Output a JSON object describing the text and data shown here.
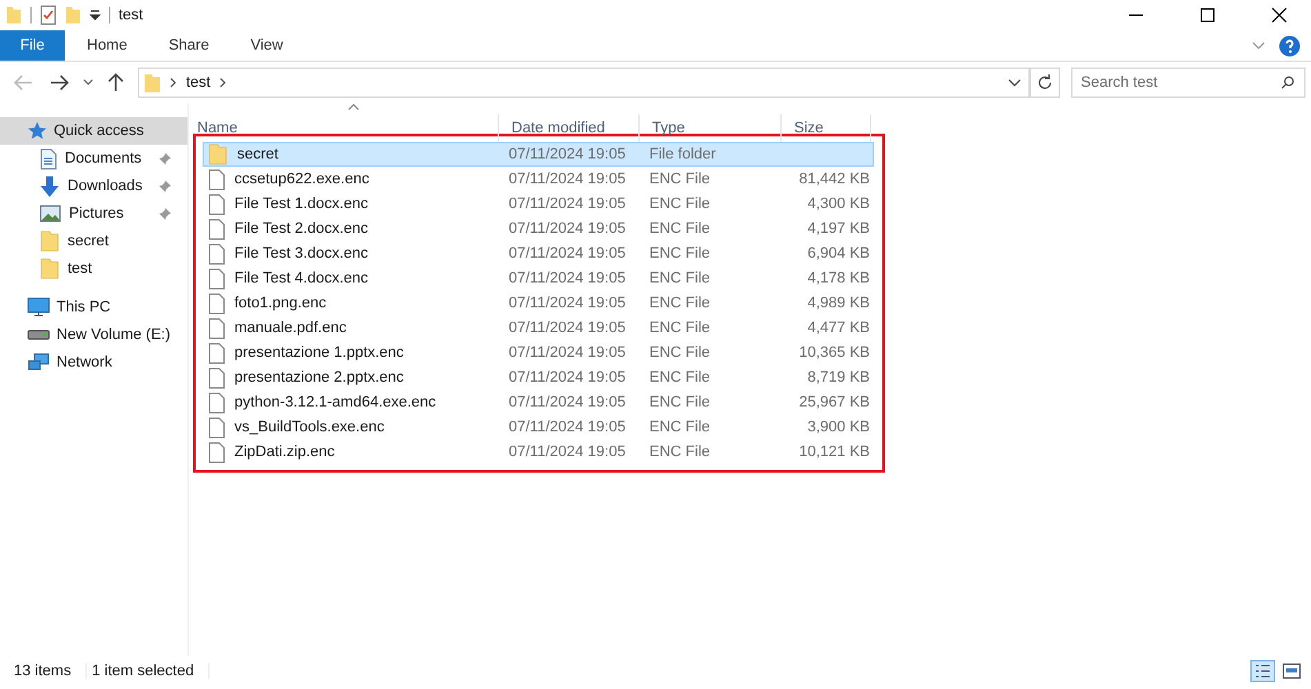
{
  "window": {
    "title": "test"
  },
  "ribbon": {
    "tabs": [
      {
        "label": "File",
        "kind": "file"
      },
      {
        "label": "Home",
        "kind": "tab",
        "selected": false
      },
      {
        "label": "Share",
        "kind": "tab",
        "selected": false
      },
      {
        "label": "View",
        "kind": "tab",
        "selected": false
      }
    ]
  },
  "address": {
    "path": [
      "test"
    ],
    "search_placeholder": "Search test"
  },
  "sidebar": {
    "items": [
      {
        "label": "Quick access",
        "kind": "star",
        "selected": true,
        "children": [
          {
            "label": "Documents",
            "kind": "documents",
            "pinned": true,
            "selected": false
          },
          {
            "label": "Downloads",
            "kind": "downloads",
            "pinned": true,
            "selected": false
          },
          {
            "label": "Pictures",
            "kind": "pictures",
            "pinned": true,
            "selected": false
          },
          {
            "label": "secret",
            "kind": "folder",
            "pinned": false,
            "selected": false
          },
          {
            "label": "test",
            "kind": "folder",
            "pinned": false,
            "selected": false
          }
        ]
      },
      {
        "label": "This PC",
        "kind": "pc",
        "selected": false
      },
      {
        "label": "New Volume (E:)",
        "kind": "drive",
        "selected": false
      },
      {
        "label": "Network",
        "kind": "network",
        "selected": false
      }
    ]
  },
  "table": {
    "columns": [
      "Name",
      "Date modified",
      "Type",
      "Size"
    ],
    "rows": [
      {
        "name": "secret",
        "kind": "folder",
        "date": "07/11/2024 19:05",
        "type": "File folder",
        "size": "",
        "selected": true
      },
      {
        "name": "ccsetup622.exe.enc",
        "kind": "file",
        "date": "07/11/2024 19:05",
        "type": "ENC File",
        "size": "81,442 KB",
        "selected": false
      },
      {
        "name": "File Test 1.docx.enc",
        "kind": "file",
        "date": "07/11/2024 19:05",
        "type": "ENC File",
        "size": "4,300 KB",
        "selected": false
      },
      {
        "name": "File Test 2.docx.enc",
        "kind": "file",
        "date": "07/11/2024 19:05",
        "type": "ENC File",
        "size": "4,197 KB",
        "selected": false
      },
      {
        "name": "File Test 3.docx.enc",
        "kind": "file",
        "date": "07/11/2024 19:05",
        "type": "ENC File",
        "size": "6,904 KB",
        "selected": false
      },
      {
        "name": "File Test 4.docx.enc",
        "kind": "file",
        "date": "07/11/2024 19:05",
        "type": "ENC File",
        "size": "4,178 KB",
        "selected": false
      },
      {
        "name": "foto1.png.enc",
        "kind": "file",
        "date": "07/11/2024 19:05",
        "type": "ENC File",
        "size": "4,989 KB",
        "selected": false
      },
      {
        "name": "manuale.pdf.enc",
        "kind": "file",
        "date": "07/11/2024 19:05",
        "type": "ENC File",
        "size": "4,477 KB",
        "selected": false
      },
      {
        "name": "presentazione 1.pptx.enc",
        "kind": "file",
        "date": "07/11/2024 19:05",
        "type": "ENC File",
        "size": "10,365 KB",
        "selected": false
      },
      {
        "name": "presentazione 2.pptx.enc",
        "kind": "file",
        "date": "07/11/2024 19:05",
        "type": "ENC File",
        "size": "8,719 KB",
        "selected": false
      },
      {
        "name": "python-3.12.1-amd64.exe.enc",
        "kind": "file",
        "date": "07/11/2024 19:05",
        "type": "ENC File",
        "size": "25,967 KB",
        "selected": false
      },
      {
        "name": "vs_BuildTools.exe.enc",
        "kind": "file",
        "date": "07/11/2024 19:05",
        "type": "ENC File",
        "size": "3,900 KB",
        "selected": false
      },
      {
        "name": "ZipDati.zip.enc",
        "kind": "file",
        "date": "07/11/2024 19:05",
        "type": "ENC File",
        "size": "10,121 KB",
        "selected": false
      }
    ]
  },
  "status_bar": {
    "count": "13 items",
    "selection": "1 item selected"
  }
}
